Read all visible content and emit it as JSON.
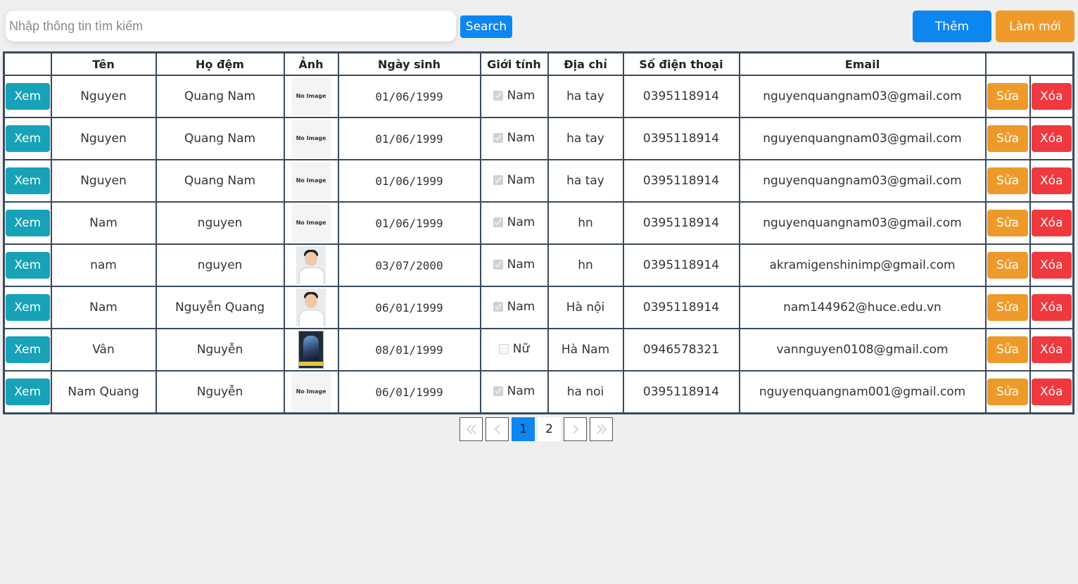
{
  "search": {
    "placeholder": "Nhập thông tin tìm kiếm",
    "button_label": "Search"
  },
  "toolbar": {
    "add_label": "Thêm",
    "refresh_label": "Làm mới"
  },
  "table": {
    "headers": [
      "",
      "Tên",
      "Họ đệm",
      "Ảnh",
      "Ngày sinh",
      "Giới tính",
      "Địa chỉ",
      "Số điện thoại",
      "Email",
      ""
    ],
    "view_label": "Xem",
    "edit_label": "Sửa",
    "delete_label": "Xóa",
    "no_image_label": "No Image",
    "rows": [
      {
        "ten": "Nguyen",
        "ho_dem": "Quang Nam",
        "photo": "no-image",
        "ngay_sinh": "01/06/1999",
        "gioi_tinh": "Nam",
        "is_male": true,
        "dia_chi": "ha tay",
        "sdt": "0395118914",
        "email": "nguyenquangnam03@gmail.com"
      },
      {
        "ten": "Nguyen",
        "ho_dem": "Quang Nam",
        "photo": "no-image",
        "ngay_sinh": "01/06/1999",
        "gioi_tinh": "Nam",
        "is_male": true,
        "dia_chi": "ha tay",
        "sdt": "0395118914",
        "email": "nguyenquangnam03@gmail.com"
      },
      {
        "ten": "Nguyen",
        "ho_dem": "Quang Nam",
        "photo": "no-image",
        "ngay_sinh": "01/06/1999",
        "gioi_tinh": "Nam",
        "is_male": true,
        "dia_chi": "ha tay",
        "sdt": "0395118914",
        "email": "nguyenquangnam03@gmail.com"
      },
      {
        "ten": "Nam",
        "ho_dem": "nguyen",
        "photo": "no-image",
        "ngay_sinh": "01/06/1999",
        "gioi_tinh": "Nam",
        "is_male": true,
        "dia_chi": "hn",
        "sdt": "0395118914",
        "email": "nguyenquangnam03@gmail.com"
      },
      {
        "ten": "nam",
        "ho_dem": "nguyen",
        "photo": "portrait",
        "ngay_sinh": "03/07/2000",
        "gioi_tinh": "Nam",
        "is_male": true,
        "dia_chi": "hn",
        "sdt": "0395118914",
        "email": "akramigenshinimp@gmail.com"
      },
      {
        "ten": "Nam",
        "ho_dem": "Nguyễn Quang",
        "photo": "portrait",
        "ngay_sinh": "06/01/1999",
        "gioi_tinh": "Nam",
        "is_male": true,
        "dia_chi": "Hà nội",
        "sdt": "0395118914",
        "email": "nam144962@huce.edu.vn"
      },
      {
        "ten": "Vân",
        "ho_dem": "Nguyễn",
        "photo": "poster",
        "ngay_sinh": "08/01/1999",
        "gioi_tinh": "Nữ",
        "is_male": false,
        "dia_chi": "Hà Nam",
        "sdt": "0946578321",
        "email": "vannguyen0108@gmail.com"
      },
      {
        "ten": "Nam Quang",
        "ho_dem": "Nguyễn",
        "photo": "no-image",
        "ngay_sinh": "06/01/1999",
        "gioi_tinh": "Nam",
        "is_male": true,
        "dia_chi": "ha noi",
        "sdt": "0395118914",
        "email": "nguyenquangnam001@gmail.com"
      }
    ]
  },
  "pagination": {
    "first_icon": "double-chevron-left-icon",
    "prev_icon": "chevron-left-icon",
    "next_icon": "chevron-right-icon",
    "last_icon": "double-chevron-right-icon",
    "pages": [
      "1",
      "2"
    ],
    "current_page": "1",
    "colors": {
      "active": "#0d86f0"
    }
  },
  "colors": {
    "primary": "#0d86f0",
    "view": "#17a2b8",
    "edit": "#ee9a2a",
    "delete": "#f0383f",
    "table_border": "#3b4a5e"
  }
}
